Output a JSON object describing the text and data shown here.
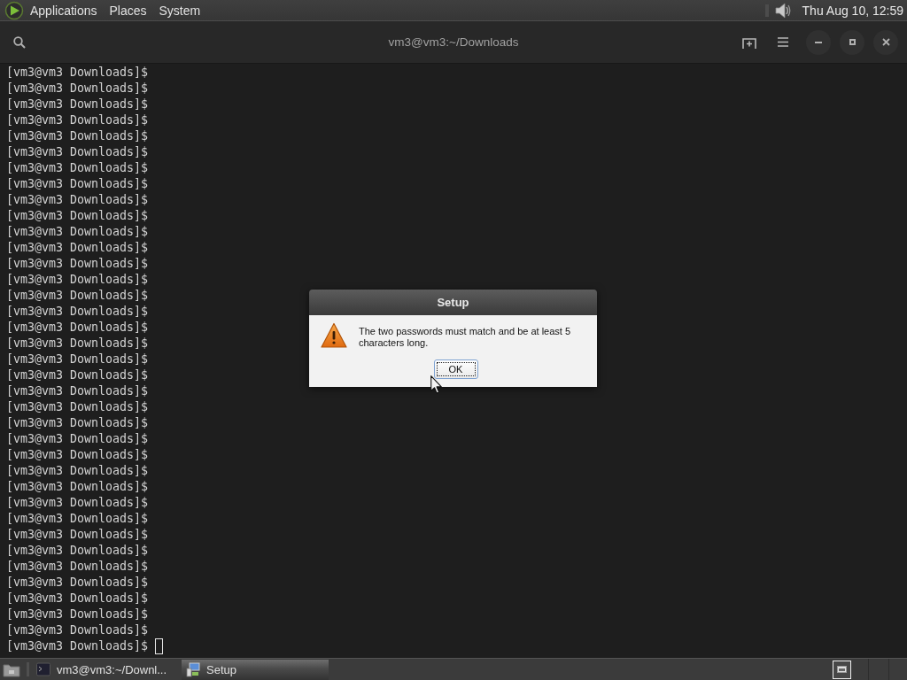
{
  "top_panel": {
    "menus": [
      "Applications",
      "Places",
      "System"
    ],
    "clock": "Thu Aug 10, 12:59"
  },
  "terminal": {
    "title": "vm3@vm3:~/Downloads",
    "lines": [
      "[vm3@vm3 Downloads]$",
      "[vm3@vm3 Downloads]$",
      "[vm3@vm3 Downloads]$",
      "[vm3@vm3 Downloads]$",
      "[vm3@vm3 Downloads]$",
      "[vm3@vm3 Downloads]$",
      "[vm3@vm3 Downloads]$",
      "[vm3@vm3 Downloads]$",
      "[vm3@vm3 Downloads]$",
      "[vm3@vm3 Downloads]$",
      "[vm3@vm3 Downloads]$",
      "[vm3@vm3 Downloads]$",
      "[vm3@vm3 Downloads]$",
      "[vm3@vm3 Downloads]$",
      "[vm3@vm3 Downloads]$",
      "[vm3@vm3 Downloads]$",
      "[vm3@vm3 Downloads]$",
      "[vm3@vm3 Downloads]$",
      "[vm3@vm3 Downloads]$",
      "[vm3@vm3 Downloads]$",
      "[vm3@vm3 Downloads]$",
      "[vm3@vm3 Downloads]$",
      "[vm3@vm3 Downloads]$",
      "[vm3@vm3 Downloads]$",
      "[vm3@vm3 Downloads]$",
      "[vm3@vm3 Downloads]$",
      "[vm3@vm3 Downloads]$",
      "[vm3@vm3 Downloads]$",
      "[vm3@vm3 Downloads]$",
      "[vm3@vm3 Downloads]$",
      "[vm3@vm3 Downloads]$",
      "[vm3@vm3 Downloads]$",
      "[vm3@vm3 Downloads]$",
      "[vm3@vm3 Downloads]$",
      "[vm3@vm3 Downloads]$",
      "[vm3@vm3 Downloads]$",
      "[vm3@vm3 Downloads]$"
    ],
    "cursor": true
  },
  "dialog": {
    "title": "Setup",
    "message": "The two passwords must match and be at least 5 characters long.",
    "buttons": [
      {
        "label": "OK",
        "focused": true
      }
    ]
  },
  "taskbar": {
    "tasks": [
      {
        "kind": "terminal",
        "label": "vm3@vm3:~/Downl...",
        "selected": false
      },
      {
        "kind": "installer",
        "label": "Setup",
        "selected": true
      }
    ]
  }
}
